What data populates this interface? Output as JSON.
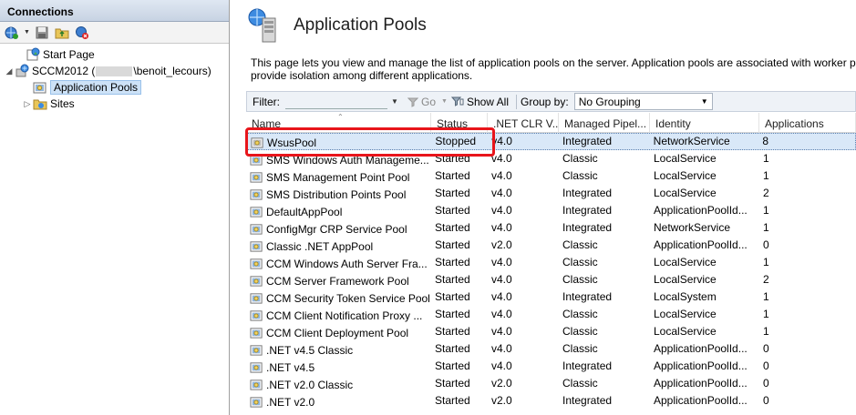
{
  "connections": {
    "header": "Connections",
    "tree": [
      {
        "label": "Start Page",
        "level": 0
      },
      {
        "label_prefix": "SCCM2012 (",
        "label_suffix": "\\benoit_lecours)",
        "level": 0
      },
      {
        "label": "Application Pools",
        "level": 1
      },
      {
        "label": "Sites",
        "level": 1
      }
    ]
  },
  "main": {
    "title": "Application Pools",
    "description": "This page lets you view and manage the list of application pools on the server. Application pools are associated with worker pro provide isolation among different applications.",
    "filter": {
      "label": "Filter:",
      "value": "",
      "go_label": "Go",
      "show_all_label": "Show All",
      "group_by_label": "Group by:",
      "group_by_value": "No Grouping"
    },
    "columns": [
      "Name",
      "Status",
      ".NET CLR V...",
      "Managed Pipel...",
      "Identity",
      "Applications"
    ],
    "rows": [
      {
        "name": "WsusPool",
        "status": "Stopped",
        "clr": "v4.0",
        "pipeline": "Integrated",
        "identity": "NetworkService",
        "apps": "8"
      },
      {
        "name": "SMS Windows Auth Manageme...",
        "status": "Started",
        "clr": "v4.0",
        "pipeline": "Classic",
        "identity": "LocalService",
        "apps": "1"
      },
      {
        "name": "SMS Management Point Pool",
        "status": "Started",
        "clr": "v4.0",
        "pipeline": "Classic",
        "identity": "LocalService",
        "apps": "1"
      },
      {
        "name": "SMS Distribution Points Pool",
        "status": "Started",
        "clr": "v4.0",
        "pipeline": "Integrated",
        "identity": "LocalService",
        "apps": "2"
      },
      {
        "name": "DefaultAppPool",
        "status": "Started",
        "clr": "v4.0",
        "pipeline": "Integrated",
        "identity": "ApplicationPoolId...",
        "apps": "1"
      },
      {
        "name": "ConfigMgr CRP Service Pool",
        "status": "Started",
        "clr": "v4.0",
        "pipeline": "Integrated",
        "identity": "NetworkService",
        "apps": "1"
      },
      {
        "name": "Classic .NET AppPool",
        "status": "Started",
        "clr": "v2.0",
        "pipeline": "Classic",
        "identity": "ApplicationPoolId...",
        "apps": "0"
      },
      {
        "name": "CCM Windows Auth Server Fra...",
        "status": "Started",
        "clr": "v4.0",
        "pipeline": "Classic",
        "identity": "LocalService",
        "apps": "1"
      },
      {
        "name": "CCM Server Framework Pool",
        "status": "Started",
        "clr": "v4.0",
        "pipeline": "Classic",
        "identity": "LocalService",
        "apps": "2"
      },
      {
        "name": "CCM Security Token Service Pool",
        "status": "Started",
        "clr": "v4.0",
        "pipeline": "Integrated",
        "identity": "LocalSystem",
        "apps": "1"
      },
      {
        "name": "CCM Client Notification Proxy ...",
        "status": "Started",
        "clr": "v4.0",
        "pipeline": "Classic",
        "identity": "LocalService",
        "apps": "1"
      },
      {
        "name": "CCM Client Deployment Pool",
        "status": "Started",
        "clr": "v4.0",
        "pipeline": "Classic",
        "identity": "LocalService",
        "apps": "1"
      },
      {
        "name": ".NET v4.5 Classic",
        "status": "Started",
        "clr": "v4.0",
        "pipeline": "Classic",
        "identity": "ApplicationPoolId...",
        "apps": "0"
      },
      {
        "name": ".NET v4.5",
        "status": "Started",
        "clr": "v4.0",
        "pipeline": "Integrated",
        "identity": "ApplicationPoolId...",
        "apps": "0"
      },
      {
        "name": ".NET v2.0 Classic",
        "status": "Started",
        "clr": "v2.0",
        "pipeline": "Classic",
        "identity": "ApplicationPoolId...",
        "apps": "0"
      },
      {
        "name": ".NET v2.0",
        "status": "Started",
        "clr": "v2.0",
        "pipeline": "Integrated",
        "identity": "ApplicationPoolId...",
        "apps": "0"
      }
    ]
  },
  "icons": {
    "connect": "globe-connect-icon",
    "save": "save-icon",
    "up": "folder-up-icon",
    "disconnect": "disconnect-icon",
    "pool": "app-pool-icon",
    "server": "server-icon",
    "sites": "sites-folder-icon",
    "start_page": "start-page-icon"
  },
  "colors": {
    "highlight": "#e8151b",
    "selected_row": "#d9e8f8"
  }
}
